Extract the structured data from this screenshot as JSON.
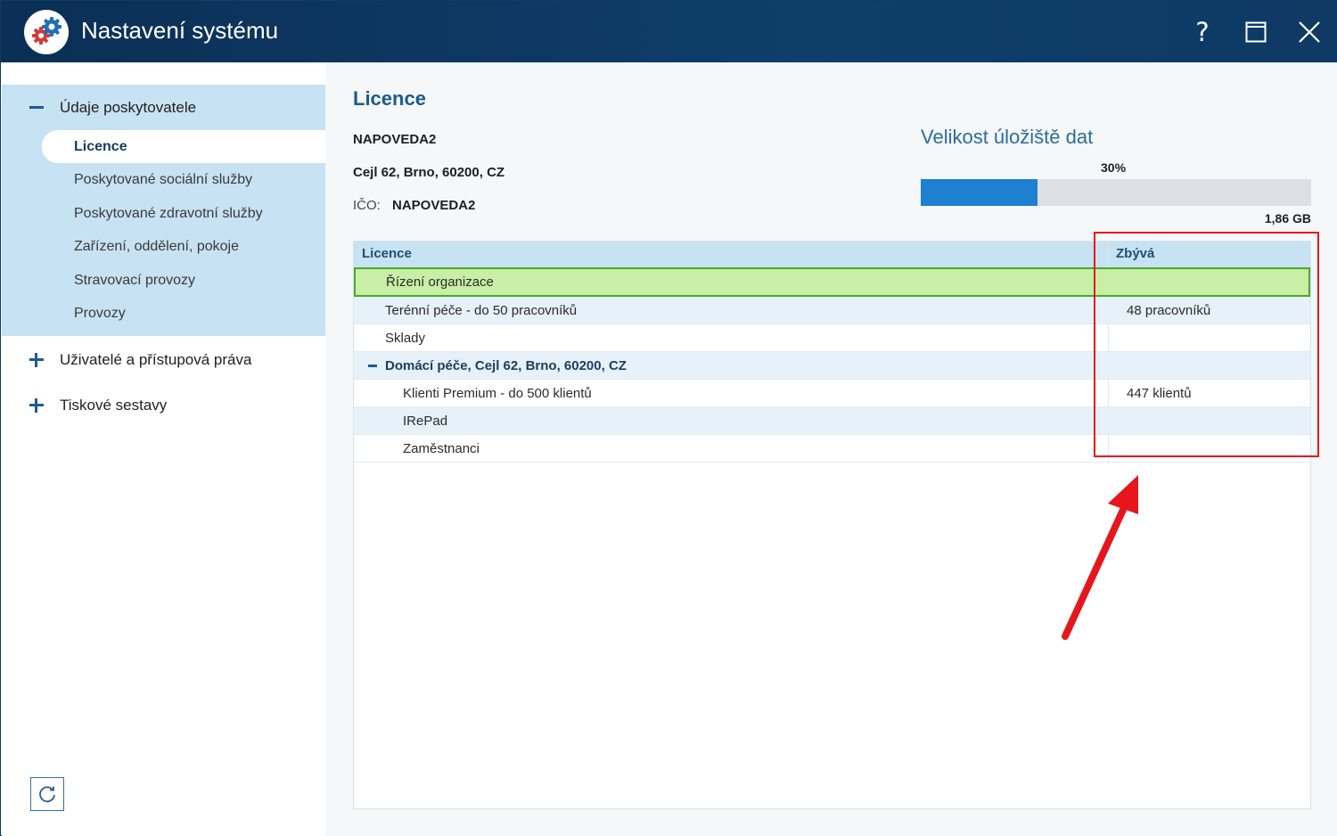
{
  "window": {
    "title": "Nastavení systému",
    "logo_icon": "gears-icon",
    "help_label": "?",
    "maximize_icon": "maximize-icon",
    "close_icon": "close-icon"
  },
  "sidebar": {
    "groups": [
      {
        "label": "Údaje poskytovatele",
        "expanded": true,
        "items": [
          {
            "label": "Licence",
            "active": true
          },
          {
            "label": "Poskytované sociální služby"
          },
          {
            "label": "Poskytované zdravotní služby"
          },
          {
            "label": "Zařízení, oddělení, pokoje"
          },
          {
            "label": "Stravovací provozy"
          },
          {
            "label": "Provozy"
          }
        ]
      },
      {
        "label": "Uživatelé a přístupová práva",
        "expanded": false
      },
      {
        "label": "Tiskové sestavy",
        "expanded": false
      }
    ],
    "refresh_icon": "refresh-icon"
  },
  "main": {
    "section_title": "Licence",
    "provider_name": "NAPOVEDA2",
    "provider_address": "Cejl 62, Brno, 60200, CZ",
    "ico_label": "IČO:",
    "ico_value": "NAPOVEDA2",
    "storage": {
      "title": "Velikost úložiště dat",
      "percent_label": "30%",
      "percent": 30,
      "size_label": "1,86 GB",
      "fill_color": "#1f7fd1"
    },
    "table": {
      "columns": [
        "Licence",
        "Zbývá"
      ],
      "rows": [
        {
          "licence": "Řízení organizace",
          "zbyva": "",
          "selected": true
        },
        {
          "licence": "Terénní péče - do 50 pracovníků",
          "zbyva": "48 pracovníků"
        },
        {
          "licence": "Sklady",
          "zbyva": ""
        },
        {
          "licence": "Domácí péče, Cejl 62, Brno, 60200, CZ",
          "zbyva": "",
          "group": true
        },
        {
          "licence": "Klienti Premium - do 500 klientů",
          "zbyva": "447 klientů"
        },
        {
          "licence": "IRePad",
          "zbyva": ""
        },
        {
          "licence": "Zaměstnanci",
          "zbyva": ""
        }
      ]
    }
  },
  "annotation": {
    "highlight_color": "#e5161d"
  }
}
